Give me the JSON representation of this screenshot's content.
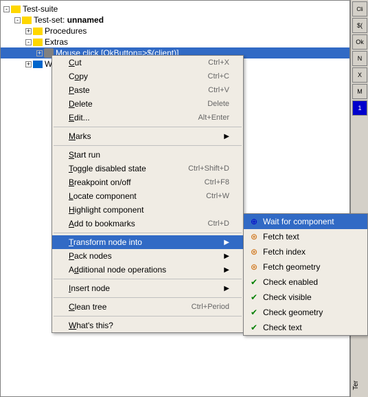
{
  "tree": {
    "items": [
      {
        "label": "Test-suite",
        "indent": 0,
        "icon": "folder",
        "expanded": true
      },
      {
        "label": "Test-set: unnamed",
        "indent": 1,
        "icon": "folder",
        "expanded": true
      },
      {
        "label": "Procedures",
        "indent": 2,
        "icon": "folder",
        "expanded": false
      },
      {
        "label": "Extras",
        "indent": 2,
        "icon": "folder",
        "expanded": true
      },
      {
        "label": "Mouse click [OkButton=>$(client)]",
        "indent": 3,
        "icon": "gear",
        "selected": true
      },
      {
        "label": "Win...",
        "indent": 2,
        "icon": "win",
        "expanded": false
      }
    ]
  },
  "context_menu": {
    "items": [
      {
        "label": "Cut",
        "underline": "C",
        "shortcut": "Ctrl+X",
        "separator_after": false
      },
      {
        "label": "Copy",
        "underline": "o",
        "shortcut": "Ctrl+C",
        "separator_after": false
      },
      {
        "label": "Paste",
        "underline": "P",
        "shortcut": "Ctrl+V",
        "separator_after": false
      },
      {
        "label": "Delete",
        "underline": "D",
        "shortcut": "Delete",
        "separator_after": false
      },
      {
        "label": "Edit...",
        "underline": "E",
        "shortcut": "Alt+Enter",
        "separator_after": true
      },
      {
        "label": "Marks",
        "underline": "M",
        "shortcut": "",
        "has_submenu": true,
        "separator_after": true
      },
      {
        "label": "Start run",
        "underline": "S",
        "shortcut": "",
        "separator_after": false
      },
      {
        "label": "Toggle disabled state",
        "underline": "T",
        "shortcut": "Ctrl+Shift+D",
        "separator_after": false
      },
      {
        "label": "Breakpoint on/off",
        "underline": "B",
        "shortcut": "Ctrl+F8",
        "separator_after": false
      },
      {
        "label": "Locate component",
        "underline": "L",
        "shortcut": "Ctrl+W",
        "separator_after": false
      },
      {
        "label": "Highlight component",
        "underline": "H",
        "shortcut": "",
        "separator_after": false
      },
      {
        "label": "Add to bookmarks",
        "underline": "A",
        "shortcut": "Ctrl+D",
        "separator_after": true
      },
      {
        "label": "Transform node into",
        "underline": "T",
        "shortcut": "",
        "has_submenu": true,
        "highlighted": true,
        "separator_after": false
      },
      {
        "label": "Pack nodes",
        "underline": "P",
        "shortcut": "",
        "has_submenu": true,
        "separator_after": false
      },
      {
        "label": "Additional node operations",
        "underline": "d",
        "shortcut": "",
        "has_submenu": true,
        "separator_after": true
      },
      {
        "label": "Insert node",
        "underline": "I",
        "shortcut": "",
        "has_submenu": true,
        "separator_after": true
      },
      {
        "label": "Clean tree",
        "underline": "C",
        "shortcut": "Ctrl+Period",
        "separator_after": true
      },
      {
        "label": "What's this?",
        "underline": "W",
        "shortcut": "",
        "separator_after": false
      }
    ]
  },
  "submenu": {
    "items": [
      {
        "label": "Wait for component",
        "icon": "wait",
        "active": true
      },
      {
        "label": "Fetch text",
        "icon": "fetch"
      },
      {
        "label": "Fetch index",
        "icon": "fetch"
      },
      {
        "label": "Fetch geometry",
        "icon": "fetch"
      },
      {
        "label": "Check enabled",
        "icon": "check"
      },
      {
        "label": "Check visible",
        "icon": "check"
      },
      {
        "label": "Check geometry",
        "icon": "check"
      },
      {
        "label": "Check text",
        "icon": "check"
      }
    ]
  },
  "right_panel": {
    "buttons": [
      "Cli",
      "$(",
      "Ok",
      "N",
      "X",
      "M",
      "1"
    ],
    "terminal_label": "Ter"
  }
}
